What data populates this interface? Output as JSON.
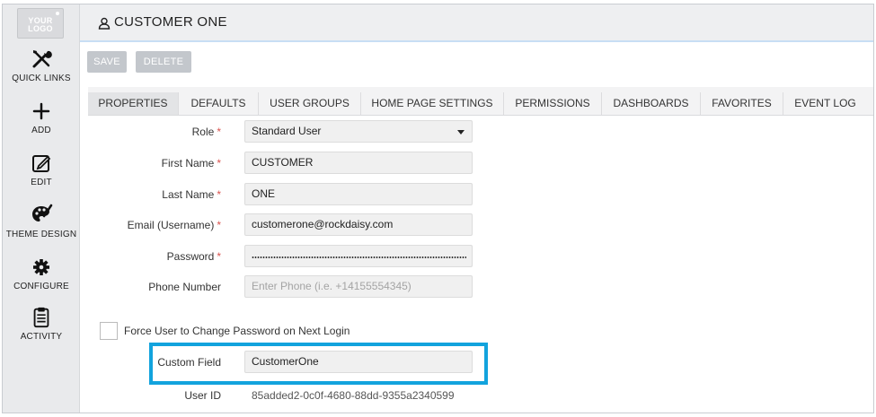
{
  "logo": {
    "line1": "YOUR",
    "line2": "LOGO"
  },
  "sidebar": {
    "items": [
      {
        "label": "QUICK LINKS",
        "icon": "tools-icon"
      },
      {
        "label": "ADD",
        "icon": "plus-icon"
      },
      {
        "label": "EDIT",
        "icon": "edit-icon"
      },
      {
        "label": "THEME DESIGN",
        "icon": "palette-icon"
      },
      {
        "label": "CONFIGURE",
        "icon": "gear-icon"
      },
      {
        "label": "ACTIVITY",
        "icon": "clipboard-icon"
      }
    ]
  },
  "header": {
    "title": "CUSTOMER ONE",
    "icon": "user-icon"
  },
  "toolbar": {
    "save_label": "SAVE",
    "delete_label": "DELETE"
  },
  "tabs": [
    "PROPERTIES",
    "DEFAULTS",
    "USER GROUPS",
    "HOME PAGE SETTINGS",
    "PERMISSIONS",
    "DASHBOARDS",
    "FAVORITES",
    "EVENT LOG"
  ],
  "active_tab": "PROPERTIES",
  "form": {
    "role": {
      "label": "Role",
      "required": "*",
      "value": "Standard User"
    },
    "first_name": {
      "label": "First Name",
      "required": "*",
      "value": "CUSTOMER"
    },
    "last_name": {
      "label": "Last Name",
      "required": "*",
      "value": "ONE"
    },
    "email": {
      "label": "Email (Username)",
      "required": "*",
      "value": "customerone@rockdaisy.com"
    },
    "password": {
      "label": "Password",
      "required": "*"
    },
    "phone": {
      "label": "Phone Number",
      "placeholder": "Enter Phone (i.e. +14155554345)"
    },
    "force_change": {
      "label": "Force User to Change Password on Next Login",
      "checked": false
    },
    "custom_field": {
      "label": "Custom Field",
      "value": "CustomerOne"
    },
    "user_id": {
      "label": "User ID",
      "value": "85added2-0c0f-4680-88dd-9355a2340599"
    }
  },
  "colors": {
    "highlight": "#12a3dd",
    "required": "#d9534f",
    "button": "#c3c7cc"
  }
}
